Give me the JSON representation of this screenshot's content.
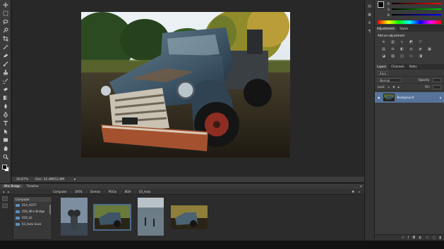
{
  "document": {
    "zoom": "16.67%",
    "doc_size": "Doc: 52.8M/52.8M"
  },
  "tools": [
    "move-tool",
    "marquee-tool",
    "lasso-tool",
    "quick-select-tool",
    "crop-tool",
    "eyedropper-tool",
    "healing-brush-tool",
    "brush-tool",
    "clone-stamp-tool",
    "history-brush-tool",
    "eraser-tool",
    "gradient-tool",
    "blur-tool",
    "dodge-tool",
    "pen-tool",
    "type-tool",
    "path-select-tool",
    "shape-tool",
    "hand-tool",
    "zoom-tool"
  ],
  "mini_bridge": {
    "tabs": [
      "Mini Bridge",
      "Timeline"
    ],
    "breadcrumb": [
      "Computer",
      "EATK",
      "Demos",
      "PSCIo",
      "8GH",
      "03_Auto"
    ],
    "sidebar_title": "Computer",
    "folders": [
      "01A_ACR7",
      "01B_Mini Bridge",
      "01B_LE",
      "03_Auto Save"
    ],
    "thumbnails": [
      {
        "name": "binoculars-thumbnail",
        "selected": false
      },
      {
        "name": "truck-thumbnail",
        "selected": true
      },
      {
        "name": "paddleboard-thumbnail",
        "selected": false
      },
      {
        "name": "truck-variant-thumbnail",
        "selected": false
      }
    ]
  },
  "color_panel": {
    "channels": [
      "R",
      "G",
      "B"
    ],
    "colors": {
      "accent": "#56739a",
      "red": "#c23a3a",
      "green": "#3aa34a",
      "blue": "#3a6cc2"
    }
  },
  "adjustments": {
    "tabs": [
      "Adjustments",
      "Styles"
    ],
    "title": "Add an adjustment"
  },
  "layers": {
    "tabs": [
      "Layers",
      "Channels",
      "Paths"
    ],
    "kind_label": "Kind",
    "blend_mode": "Normal",
    "opacity_label": "Opacity:",
    "lock_label": "Lock:",
    "fill_label": "Fill:",
    "items": [
      {
        "name": "Background",
        "visible": true,
        "locked": true
      }
    ]
  }
}
